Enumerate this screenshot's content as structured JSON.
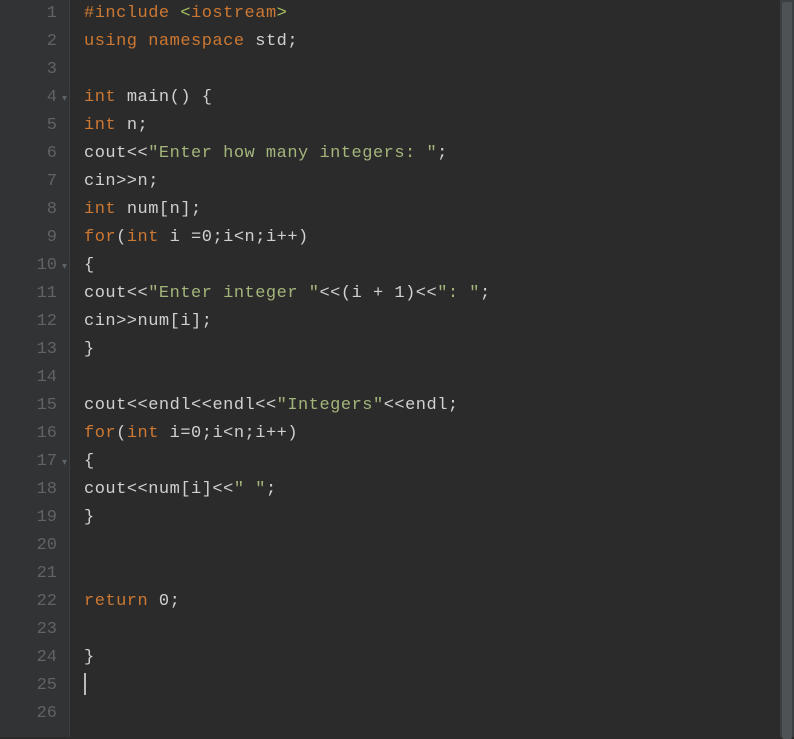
{
  "gutter": {
    "lines": [
      "1",
      "2",
      "3",
      "4",
      "5",
      "6",
      "7",
      "8",
      "9",
      "10",
      "11",
      "12",
      "13",
      "14",
      "15",
      "16",
      "17",
      "18",
      "19",
      "20",
      "21",
      "22",
      "23",
      "24",
      "25",
      "26"
    ],
    "fold_lines": [
      4,
      10,
      17
    ]
  },
  "code": {
    "l1": {
      "a": "#include ",
      "b": "<",
      "c": "iostream",
      "d": ">"
    },
    "l2": {
      "a": "using ",
      "b": "namespace ",
      "c": "std",
      "d": ";"
    },
    "l3": "",
    "l4": {
      "a": "int ",
      "b": "main",
      "c": "() {"
    },
    "l5": {
      "a": "int ",
      "b": "n",
      "c": ";"
    },
    "l6": {
      "a": "cout",
      "b": "<<",
      "c": "\"Enter how many integers: \"",
      "d": ";"
    },
    "l7": {
      "a": "cin",
      "b": ">>",
      "c": "n",
      "d": ";"
    },
    "l8": {
      "a": "int ",
      "b": "num",
      "c": "[",
      "d": "n",
      "e": "];"
    },
    "l9": {
      "a": "for",
      "b": "(",
      "c": "int ",
      "d": "i ",
      "e": "=",
      "f": "0",
      "g": ";",
      "h": "i",
      "i": "<",
      "j": "n",
      "k": ";",
      "l": "i",
      "m": "++)"
    },
    "l10": {
      "a": "{"
    },
    "l11": {
      "a": "cout",
      "b": "<<",
      "c": "\"Enter integer \"",
      "d": "<<(",
      "e": "i ",
      "f": "+ ",
      "g": "1",
      "h": ")<<",
      "i": "\": \"",
      "j": ";"
    },
    "l12": {
      "a": "cin",
      "b": ">>",
      "c": "num",
      "d": "[",
      "e": "i",
      "f": "];"
    },
    "l13": {
      "a": "}"
    },
    "l14": "",
    "l15": {
      "a": "cout",
      "b": "<<",
      "c": "endl",
      "d": "<<",
      "e": "endl",
      "f": "<<",
      "g": "\"Integers\"",
      "h": "<<",
      "i": "endl",
      "j": ";"
    },
    "l16": {
      "a": "for",
      "b": "(",
      "c": "int ",
      "d": "i",
      "e": "=",
      "f": "0",
      "g": ";",
      "h": "i",
      "i": "<",
      "j": "n",
      "k": ";",
      "l": "i",
      "m": "++)"
    },
    "l17": {
      "a": "{"
    },
    "l18": {
      "a": "cout",
      "b": "<<",
      "c": "num",
      "d": "[",
      "e": "i",
      "f": "]<<",
      "g": "\" \"",
      "h": ";"
    },
    "l19": {
      "a": "}"
    },
    "l20": "",
    "l21": "",
    "l22": {
      "a": "return ",
      "b": "0",
      "c": ";"
    },
    "l23": "",
    "l24": {
      "a": "}"
    },
    "l25": "",
    "l26": ""
  }
}
